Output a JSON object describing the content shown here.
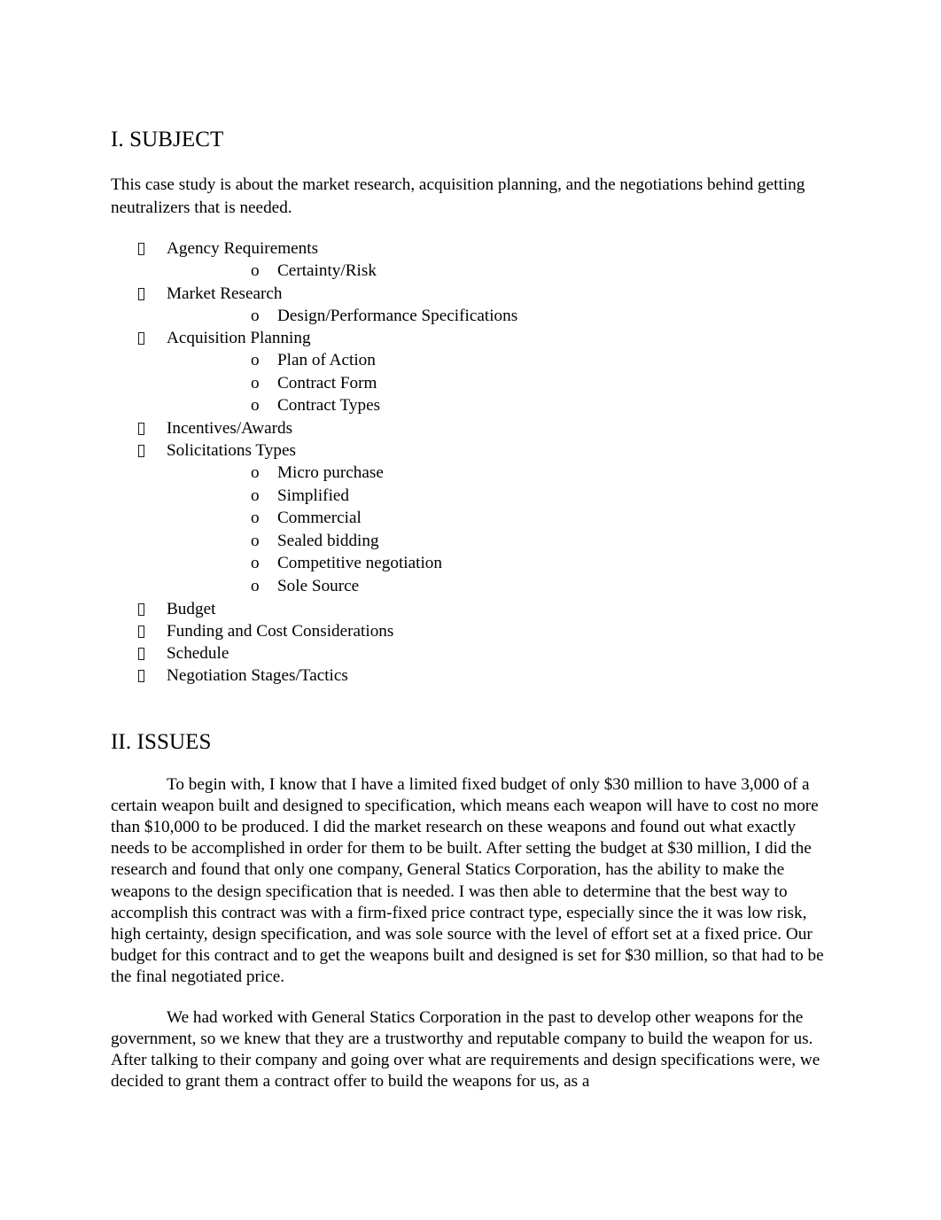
{
  "document": {
    "sections": [
      {
        "heading": "I. SUBJECT",
        "lead_paragraph": "This case study is about the market research, acquisition planning, and the negotiations behind getting neutralizers that is needed.",
        "outline": [
          {
            "label": "Agency Requirements",
            "sub_items": [
              "Certainty/Risk"
            ]
          },
          {
            "label": "Market Research",
            "sub_items": [
              "Design/Performance Specifications"
            ]
          },
          {
            "label": "Acquisition Planning",
            "sub_items": [
              "Plan of Action",
              "Contract Form",
              "Contract Types"
            ]
          },
          {
            "label": "Incentives/Awards",
            "sub_items": []
          },
          {
            "label": "Solicitations Types",
            "sub_items": [
              "Micro purchase",
              "Simplified",
              "Commercial",
              "Sealed bidding",
              "Competitive negotiation",
              "Sole Source"
            ]
          },
          {
            "label": "Budget",
            "sub_items": []
          },
          {
            "label": "Funding and Cost Considerations",
            "sub_items": []
          },
          {
            "label": "Schedule",
            "sub_items": []
          },
          {
            "label": "Negotiation Stages/Tactics",
            "sub_items": []
          }
        ]
      },
      {
        "heading": "II. ISSUES",
        "paragraphs": [
          "To begin with, I know that I have a limited fixed budget of only $30 million to have 3,000 of a certain weapon built and designed to specification, which means each weapon will have to cost no more than $10,000 to be produced. I did the market research on these weapons and found out what exactly needs to be accomplished in order for them to be built. After setting the budget at $30 million, I did the research and found that only one company, General Statics Corporation, has the ability to make the weapons to the design specification that is needed. I was then able to determine that the best way to accomplish this contract was with a firm-fixed price contract type, especially since the it was low risk, high certainty, design specification, and was sole source with the level of effort set at a fixed price. Our budget for this contract and to get the weapons built and designed is set for $30 million, so that had to be the final negotiated price.",
          "We had worked with General Statics Corporation in the past to develop other weapons for the government, so we knew that they are a trustworthy and reputable company to build the weapon for us. After talking to their company and going over what are requirements and design specifications were, we decided to grant them a contract offer to build the weapons for us, as a"
        ]
      }
    ],
    "markers": {
      "bullet_glyph": "missing-glyph-box",
      "sub_bullet_glyph": "o"
    },
    "colors": {
      "page_background": "#ffffff",
      "text": "#000000"
    }
  }
}
